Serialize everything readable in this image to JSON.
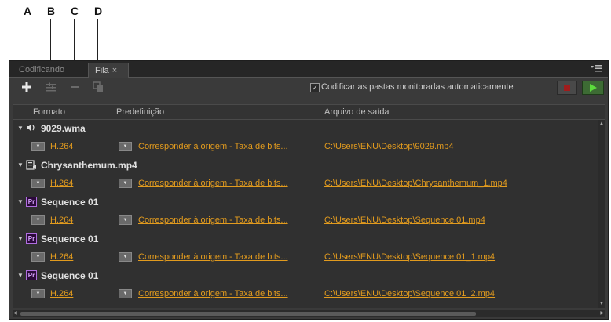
{
  "callouts": [
    "A",
    "B",
    "C",
    "D"
  ],
  "tabs": {
    "inactive_label": "Codificando",
    "active_label": "Fila",
    "close_glyph": "×"
  },
  "toolbar": {
    "add_icon": "plus-icon",
    "settings_icon": "source-settings-icon",
    "remove_icon": "minus-icon",
    "duplicate_icon": "duplicate-icon",
    "auto_encode_checked": true,
    "auto_encode_label": "Codificar as pastas monitoradas automaticamente",
    "stop_color": "#a01c1c",
    "start_color": "#5cdc3c"
  },
  "columns": {
    "format": "Formato",
    "preset": "Predefinição",
    "output": "Arquivo de saída"
  },
  "queue": [
    {
      "name": "9029.wma",
      "icon": "audio-icon",
      "format": "H.264",
      "preset": "Corresponder à origem - Taxa de bits...",
      "output": "C:\\Users\\ENU\\Desktop\\9029.mp4"
    },
    {
      "name": "Chrysanthemum.mp4",
      "icon": "video-file-icon",
      "format": "H.264",
      "preset": "Corresponder à origem - Taxa de bits...",
      "output": "C:\\Users\\ENU\\Desktop\\Chrysanthemum_1.mp4"
    },
    {
      "name": "Sequence 01",
      "icon": "premiere-icon",
      "icon_text": "Pr",
      "format": "H.264",
      "preset": "Corresponder à origem - Taxa de bits...",
      "output": "C:\\Users\\ENU\\Desktop\\Sequence 01.mp4"
    },
    {
      "name": "Sequence 01",
      "icon": "premiere-icon",
      "icon_text": "Pr",
      "format": "H.264",
      "preset": "Corresponder à origem - Taxa de bits...",
      "output": "C:\\Users\\ENU\\Desktop\\Sequence 01_1.mp4"
    },
    {
      "name": "Sequence 01",
      "icon": "premiere-icon",
      "icon_text": "Pr",
      "format": "H.264",
      "preset": "Corresponder à origem - Taxa de bits...",
      "output": "C:\\Users\\ENU\\Desktop\\Sequence 01_2.mp4"
    }
  ],
  "colors": {
    "link": "#e29b1e",
    "panel_bg": "#3a3a3a",
    "premiere_border": "#b06ee0"
  }
}
